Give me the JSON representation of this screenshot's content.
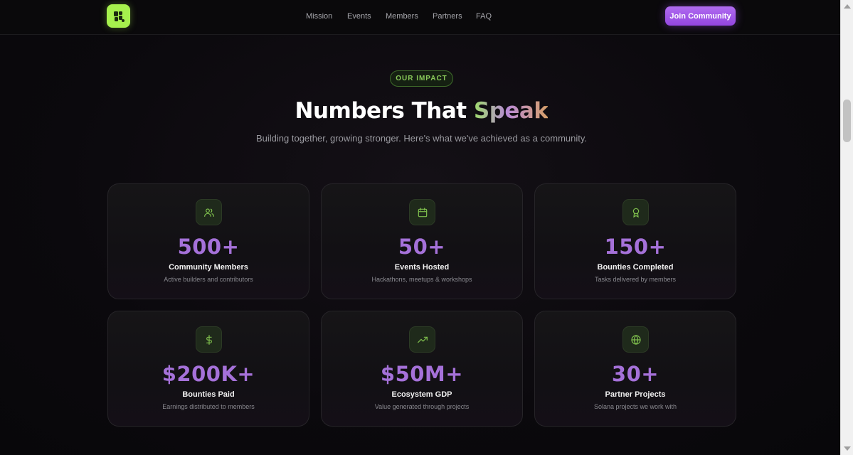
{
  "nav": {
    "links": [
      "Mission",
      "Events",
      "Members",
      "Partners",
      "FAQ"
    ],
    "cta": "Join Community"
  },
  "section": {
    "badge": "OUR IMPACT",
    "title_main": "Numbers That",
    "title_accent": "Speak",
    "subtitle": "Building together, growing stronger. Here's what we've achieved as a community."
  },
  "stats": [
    {
      "icon": "users-icon",
      "value": "500+",
      "label": "Community Members",
      "desc": "Active builders and contributors"
    },
    {
      "icon": "calendar-icon",
      "value": "50+",
      "label": "Events Hosted",
      "desc": "Hackathons, meetups & workshops"
    },
    {
      "icon": "award-icon",
      "value": "150+",
      "label": "Bounties Completed",
      "desc": "Tasks delivered by members"
    },
    {
      "icon": "dollar-icon",
      "value": "$200K+",
      "label": "Bounties Paid",
      "desc": "Earnings distributed to members"
    },
    {
      "icon": "trending-up-icon",
      "value": "$50M+",
      "label": "Ecosystem GDP",
      "desc": "Value generated through projects"
    },
    {
      "icon": "globe-icon",
      "value": "30+",
      "label": "Partner Projects",
      "desc": "Solana projects we work with"
    }
  ],
  "colors": {
    "accent_purple": "#a571d9",
    "accent_green": "#a6f14d",
    "button": "#9b55e6"
  }
}
